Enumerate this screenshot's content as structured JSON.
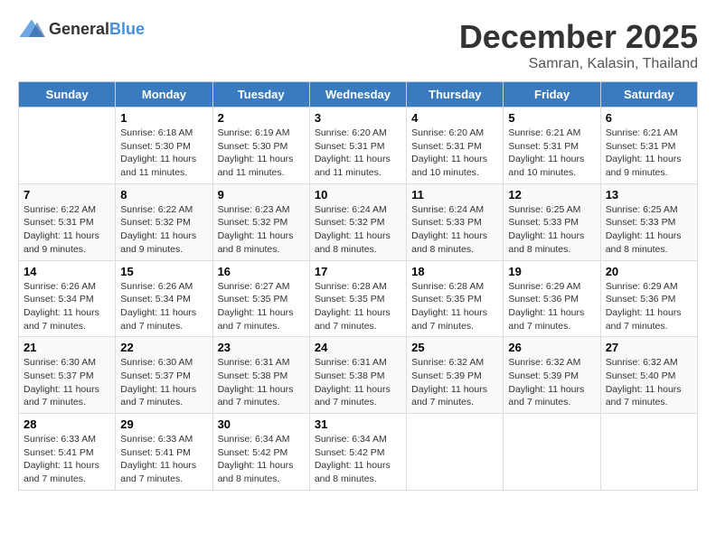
{
  "header": {
    "logo_general": "General",
    "logo_blue": "Blue",
    "title": "December 2025",
    "subtitle": "Samran, Kalasin, Thailand"
  },
  "calendar": {
    "weekdays": [
      "Sunday",
      "Monday",
      "Tuesday",
      "Wednesday",
      "Thursday",
      "Friday",
      "Saturday"
    ],
    "weeks": [
      [
        {
          "day": "",
          "sunrise": "",
          "sunset": "",
          "daylight": ""
        },
        {
          "day": "1",
          "sunrise": "Sunrise: 6:18 AM",
          "sunset": "Sunset: 5:30 PM",
          "daylight": "Daylight: 11 hours and 11 minutes."
        },
        {
          "day": "2",
          "sunrise": "Sunrise: 6:19 AM",
          "sunset": "Sunset: 5:30 PM",
          "daylight": "Daylight: 11 hours and 11 minutes."
        },
        {
          "day": "3",
          "sunrise": "Sunrise: 6:20 AM",
          "sunset": "Sunset: 5:31 PM",
          "daylight": "Daylight: 11 hours and 11 minutes."
        },
        {
          "day": "4",
          "sunrise": "Sunrise: 6:20 AM",
          "sunset": "Sunset: 5:31 PM",
          "daylight": "Daylight: 11 hours and 10 minutes."
        },
        {
          "day": "5",
          "sunrise": "Sunrise: 6:21 AM",
          "sunset": "Sunset: 5:31 PM",
          "daylight": "Daylight: 11 hours and 10 minutes."
        },
        {
          "day": "6",
          "sunrise": "Sunrise: 6:21 AM",
          "sunset": "Sunset: 5:31 PM",
          "daylight": "Daylight: 11 hours and 9 minutes."
        }
      ],
      [
        {
          "day": "7",
          "sunrise": "Sunrise: 6:22 AM",
          "sunset": "Sunset: 5:31 PM",
          "daylight": "Daylight: 11 hours and 9 minutes."
        },
        {
          "day": "8",
          "sunrise": "Sunrise: 6:22 AM",
          "sunset": "Sunset: 5:32 PM",
          "daylight": "Daylight: 11 hours and 9 minutes."
        },
        {
          "day": "9",
          "sunrise": "Sunrise: 6:23 AM",
          "sunset": "Sunset: 5:32 PM",
          "daylight": "Daylight: 11 hours and 8 minutes."
        },
        {
          "day": "10",
          "sunrise": "Sunrise: 6:24 AM",
          "sunset": "Sunset: 5:32 PM",
          "daylight": "Daylight: 11 hours and 8 minutes."
        },
        {
          "day": "11",
          "sunrise": "Sunrise: 6:24 AM",
          "sunset": "Sunset: 5:33 PM",
          "daylight": "Daylight: 11 hours and 8 minutes."
        },
        {
          "day": "12",
          "sunrise": "Sunrise: 6:25 AM",
          "sunset": "Sunset: 5:33 PM",
          "daylight": "Daylight: 11 hours and 8 minutes."
        },
        {
          "day": "13",
          "sunrise": "Sunrise: 6:25 AM",
          "sunset": "Sunset: 5:33 PM",
          "daylight": "Daylight: 11 hours and 8 minutes."
        }
      ],
      [
        {
          "day": "14",
          "sunrise": "Sunrise: 6:26 AM",
          "sunset": "Sunset: 5:34 PM",
          "daylight": "Daylight: 11 hours and 7 minutes."
        },
        {
          "day": "15",
          "sunrise": "Sunrise: 6:26 AM",
          "sunset": "Sunset: 5:34 PM",
          "daylight": "Daylight: 11 hours and 7 minutes."
        },
        {
          "day": "16",
          "sunrise": "Sunrise: 6:27 AM",
          "sunset": "Sunset: 5:35 PM",
          "daylight": "Daylight: 11 hours and 7 minutes."
        },
        {
          "day": "17",
          "sunrise": "Sunrise: 6:28 AM",
          "sunset": "Sunset: 5:35 PM",
          "daylight": "Daylight: 11 hours and 7 minutes."
        },
        {
          "day": "18",
          "sunrise": "Sunrise: 6:28 AM",
          "sunset": "Sunset: 5:35 PM",
          "daylight": "Daylight: 11 hours and 7 minutes."
        },
        {
          "day": "19",
          "sunrise": "Sunrise: 6:29 AM",
          "sunset": "Sunset: 5:36 PM",
          "daylight": "Daylight: 11 hours and 7 minutes."
        },
        {
          "day": "20",
          "sunrise": "Sunrise: 6:29 AM",
          "sunset": "Sunset: 5:36 PM",
          "daylight": "Daylight: 11 hours and 7 minutes."
        }
      ],
      [
        {
          "day": "21",
          "sunrise": "Sunrise: 6:30 AM",
          "sunset": "Sunset: 5:37 PM",
          "daylight": "Daylight: 11 hours and 7 minutes."
        },
        {
          "day": "22",
          "sunrise": "Sunrise: 6:30 AM",
          "sunset": "Sunset: 5:37 PM",
          "daylight": "Daylight: 11 hours and 7 minutes."
        },
        {
          "day": "23",
          "sunrise": "Sunrise: 6:31 AM",
          "sunset": "Sunset: 5:38 PM",
          "daylight": "Daylight: 11 hours and 7 minutes."
        },
        {
          "day": "24",
          "sunrise": "Sunrise: 6:31 AM",
          "sunset": "Sunset: 5:38 PM",
          "daylight": "Daylight: 11 hours and 7 minutes."
        },
        {
          "day": "25",
          "sunrise": "Sunrise: 6:32 AM",
          "sunset": "Sunset: 5:39 PM",
          "daylight": "Daylight: 11 hours and 7 minutes."
        },
        {
          "day": "26",
          "sunrise": "Sunrise: 6:32 AM",
          "sunset": "Sunset: 5:39 PM",
          "daylight": "Daylight: 11 hours and 7 minutes."
        },
        {
          "day": "27",
          "sunrise": "Sunrise: 6:32 AM",
          "sunset": "Sunset: 5:40 PM",
          "daylight": "Daylight: 11 hours and 7 minutes."
        }
      ],
      [
        {
          "day": "28",
          "sunrise": "Sunrise: 6:33 AM",
          "sunset": "Sunset: 5:41 PM",
          "daylight": "Daylight: 11 hours and 7 minutes."
        },
        {
          "day": "29",
          "sunrise": "Sunrise: 6:33 AM",
          "sunset": "Sunset: 5:41 PM",
          "daylight": "Daylight: 11 hours and 7 minutes."
        },
        {
          "day": "30",
          "sunrise": "Sunrise: 6:34 AM",
          "sunset": "Sunset: 5:42 PM",
          "daylight": "Daylight: 11 hours and 8 minutes."
        },
        {
          "day": "31",
          "sunrise": "Sunrise: 6:34 AM",
          "sunset": "Sunset: 5:42 PM",
          "daylight": "Daylight: 11 hours and 8 minutes."
        },
        {
          "day": "",
          "sunrise": "",
          "sunset": "",
          "daylight": ""
        },
        {
          "day": "",
          "sunrise": "",
          "sunset": "",
          "daylight": ""
        },
        {
          "day": "",
          "sunrise": "",
          "sunset": "",
          "daylight": ""
        }
      ]
    ]
  }
}
